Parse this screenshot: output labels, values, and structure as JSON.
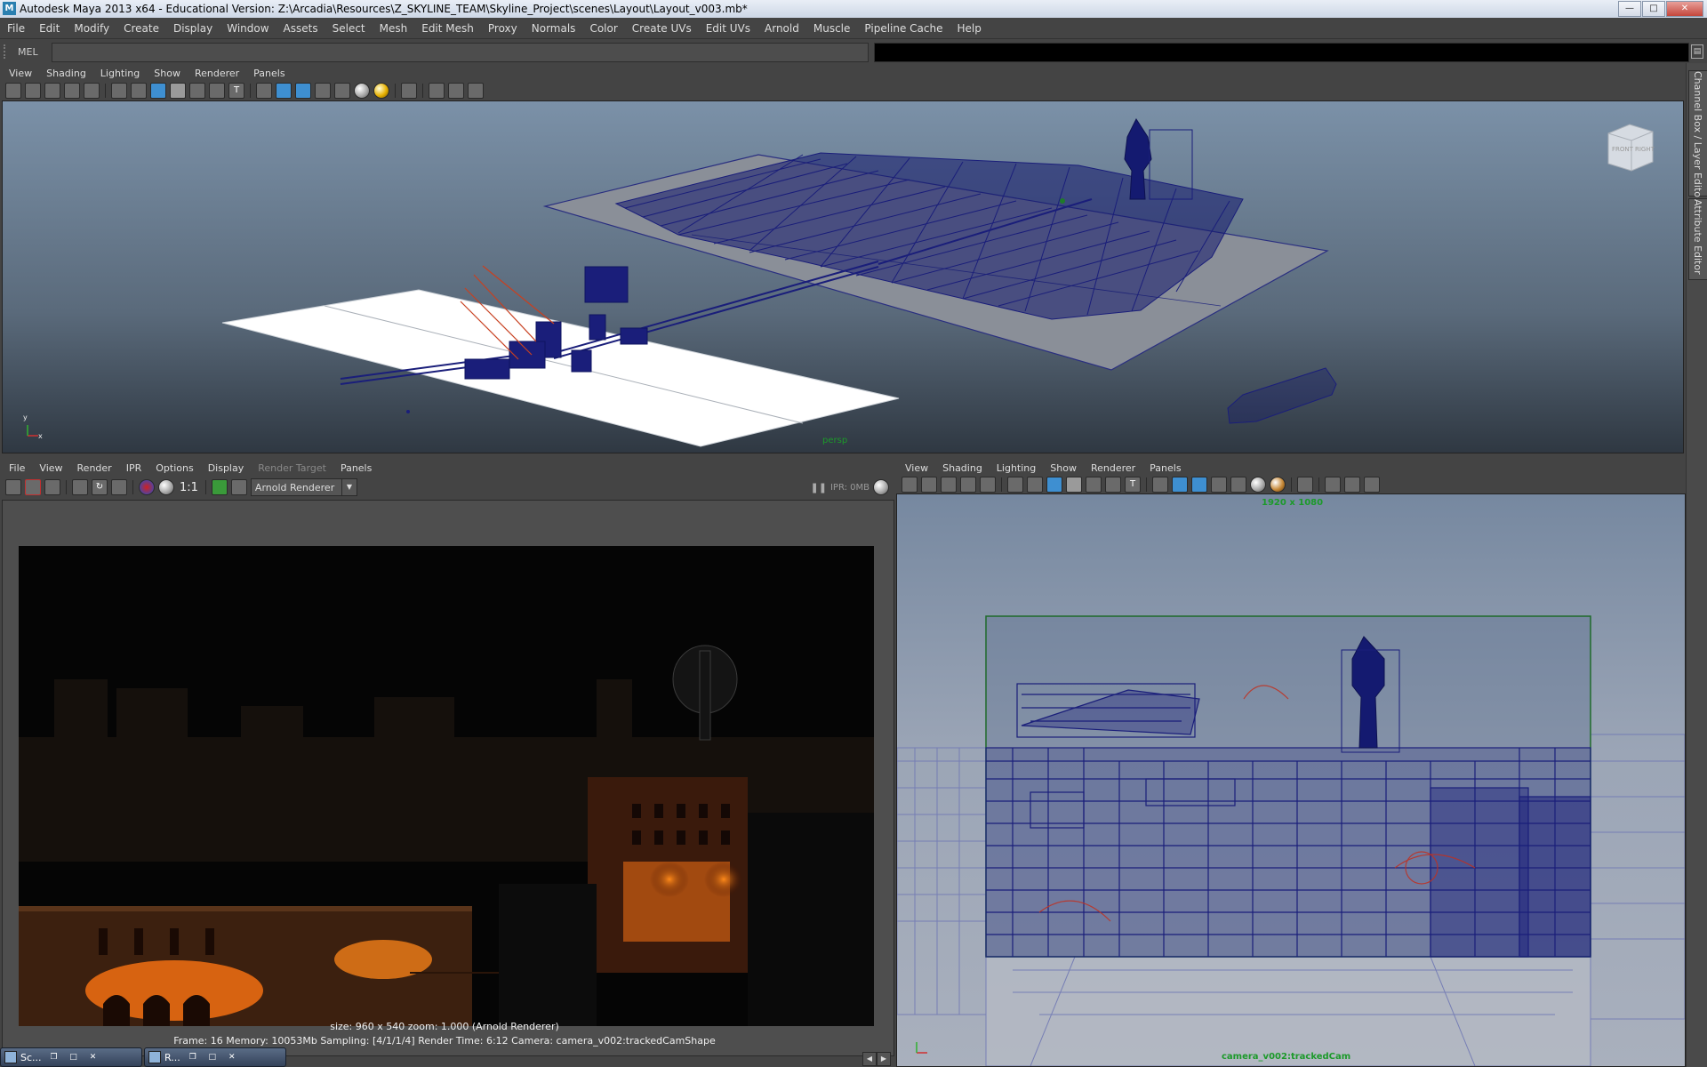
{
  "window": {
    "title": "Autodesk Maya 2013 x64 - Educational Version: Z:\\Arcadia\\Resources\\Z_SKYLINE_TEAM\\Skyline_Project\\scenes\\Layout\\Layout_v003.mb*",
    "minimize": "—",
    "maximize": "□",
    "close": "✕"
  },
  "menubar": [
    "File",
    "Edit",
    "Modify",
    "Create",
    "Display",
    "Window",
    "Assets",
    "Select",
    "Mesh",
    "Edit Mesh",
    "Proxy",
    "Normals",
    "Color",
    "Create UVs",
    "Edit UVs",
    "Arnold",
    "Muscle",
    "Pipeline Cache",
    "Help"
  ],
  "command": {
    "label": "MEL"
  },
  "side_tabs": {
    "channel_box": "Channel Box / Layer Editor",
    "attribute_editor": "Attribute Editor"
  },
  "top_panel": {
    "menu": [
      "View",
      "Shading",
      "Lighting",
      "Show",
      "Renderer",
      "Panels"
    ],
    "camera_label": "persp",
    "viewcube": {
      "front": "FRONT",
      "right": "RIGHT"
    },
    "axis": {
      "x": "x",
      "y": "y"
    }
  },
  "render_view": {
    "menu": [
      "File",
      "View",
      "Render",
      "IPR",
      "Options",
      "Display",
      "Render Target",
      "Panels"
    ],
    "ratio_label": "1:1",
    "renderer": "Arnold Renderer",
    "ipr_status": "IPR: 0MB",
    "status_line1": "size: 960 x 540  zoom: 1.000     (Arnold Renderer)",
    "status_line2": "Frame: 16     Memory: 10053Mb     Sampling: [4/1/1/4]     Render Time: 6:12     Camera: camera_v002:trackedCamShape"
  },
  "cam_panel": {
    "menu": [
      "View",
      "Shading",
      "Lighting",
      "Show",
      "Renderer",
      "Panels"
    ],
    "resolution_label": "1920 x 1080",
    "camera_label": "camera_v002:trackedCam"
  },
  "taskbar": [
    {
      "label": "Sc..."
    },
    {
      "label": "R..."
    }
  ],
  "colors": {
    "accent_green": "#1c9a2a",
    "wireframe_blue": "#1a1e7a",
    "panel_bg": "#444444"
  }
}
